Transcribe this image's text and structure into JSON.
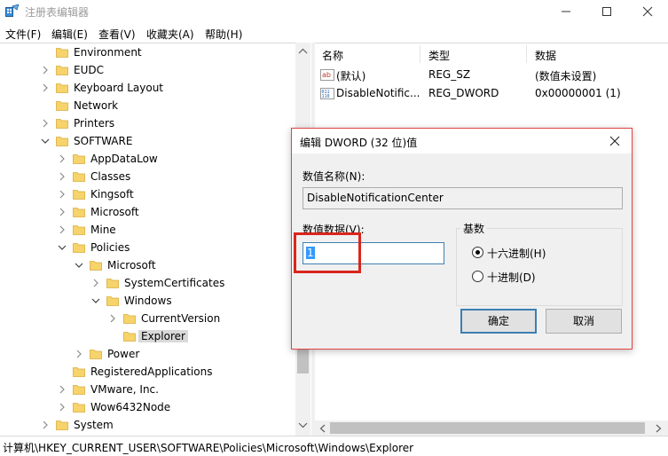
{
  "window": {
    "title": "注册表编辑器"
  },
  "menu": [
    {
      "label": "文件(F)"
    },
    {
      "label": "编辑(E)"
    },
    {
      "label": "查看(V)"
    },
    {
      "label": "收藏夹(A)"
    },
    {
      "label": "帮助(H)"
    }
  ],
  "tree": [
    {
      "label": "Environment",
      "twisty": "none"
    },
    {
      "label": "EUDC",
      "twisty": "collapsed"
    },
    {
      "label": "Keyboard Layout",
      "twisty": "collapsed"
    },
    {
      "label": "Network",
      "twisty": "none"
    },
    {
      "label": "Printers",
      "twisty": "collapsed"
    },
    {
      "label": "SOFTWARE",
      "twisty": "expanded"
    },
    {
      "label": "AppDataLow",
      "twisty": "collapsed"
    },
    {
      "label": "Classes",
      "twisty": "collapsed"
    },
    {
      "label": "Kingsoft",
      "twisty": "collapsed"
    },
    {
      "label": "Microsoft",
      "twisty": "collapsed"
    },
    {
      "label": "Mine",
      "twisty": "collapsed"
    },
    {
      "label": "Policies",
      "twisty": "expanded"
    },
    {
      "label": "Microsoft",
      "twisty": "expanded"
    },
    {
      "label": "SystemCertificates",
      "twisty": "collapsed"
    },
    {
      "label": "Windows",
      "twisty": "expanded"
    },
    {
      "label": "CurrentVersion",
      "twisty": "collapsed"
    },
    {
      "label": "Explorer",
      "twisty": "none",
      "selected": true
    },
    {
      "label": "Power",
      "twisty": "collapsed"
    },
    {
      "label": "RegisteredApplications",
      "twisty": "none"
    },
    {
      "label": "VMware, Inc.",
      "twisty": "collapsed"
    },
    {
      "label": "Wow6432Node",
      "twisty": "collapsed"
    },
    {
      "label": "System",
      "twisty": "collapsed"
    }
  ],
  "list": {
    "columns": {
      "name": "名称",
      "type": "类型",
      "data": "数据"
    },
    "rows": [
      {
        "icon": "string-value-icon",
        "name": "(默认)",
        "type": "REG_SZ",
        "data": "(数值未设置)"
      },
      {
        "icon": "dword-value-icon",
        "name": "DisableNotific...",
        "type": "REG_DWORD",
        "data": "0x00000001 (1)"
      }
    ]
  },
  "status": {
    "path": "计算机\\HKEY_CURRENT_USER\\SOFTWARE\\Policies\\Microsoft\\Windows\\Explorer"
  },
  "dialog": {
    "title": "编辑 DWORD (32 位)值",
    "name_label": "数值名称(N):",
    "name_value": "DisableNotificationCenter",
    "data_label": "数值数据(V):",
    "data_value": "1",
    "base_label": "基数",
    "radio_hex": "十六进制(H)",
    "radio_dec": "十进制(D)",
    "selected_base": "hex",
    "ok_label": "确定",
    "cancel_label": "取消"
  },
  "colors": {
    "folder": "#f6d36b",
    "dialog_border": "#e04343",
    "highlight_box": "#d9261c",
    "selection": "#3399ff"
  }
}
